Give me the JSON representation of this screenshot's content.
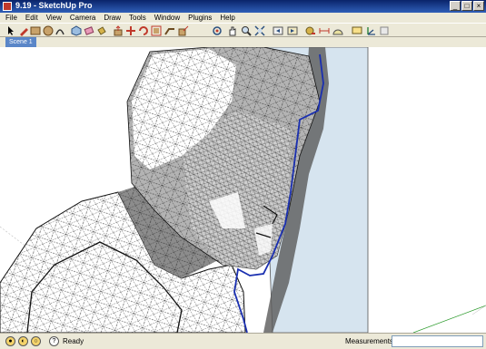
{
  "window": {
    "title": "9.19 - SketchUp Pro"
  },
  "menu": [
    "File",
    "Edit",
    "View",
    "Camera",
    "Draw",
    "Tools",
    "Window",
    "Plugins",
    "Help"
  ],
  "toolbar": {
    "tools": [
      "select-icon",
      "pencil-icon",
      "rectangle-icon",
      "circle-icon",
      "arc-icon",
      "make-component-icon",
      "eraser-icon",
      "paint-bucket-icon",
      "push-pull-icon",
      "move-icon",
      "rotate-icon",
      "offset-icon",
      "follow-me-icon",
      "scale-icon",
      "orbit-icon",
      "pan-icon",
      "zoom-icon",
      "zoom-extents-icon",
      "previous-view-icon",
      "next-view-icon",
      "tape-measure-icon",
      "dimension-icon",
      "protractor-icon",
      "text-icon",
      "axes-icon",
      "3d-text-icon",
      "get-models-icon",
      "share-model-icon",
      "components-icon"
    ]
  },
  "scenes": {
    "active": "Scene 1"
  },
  "status": {
    "text": "Ready",
    "measurements_label": "Measurements",
    "measurements_value": ""
  },
  "colors": {
    "titlebar": "#0a246a",
    "chrome": "#ece9d8",
    "scene_tab": "#5a86c8",
    "backdrop": "#d6e4ef",
    "edge_blue": "#1a2fb0"
  }
}
